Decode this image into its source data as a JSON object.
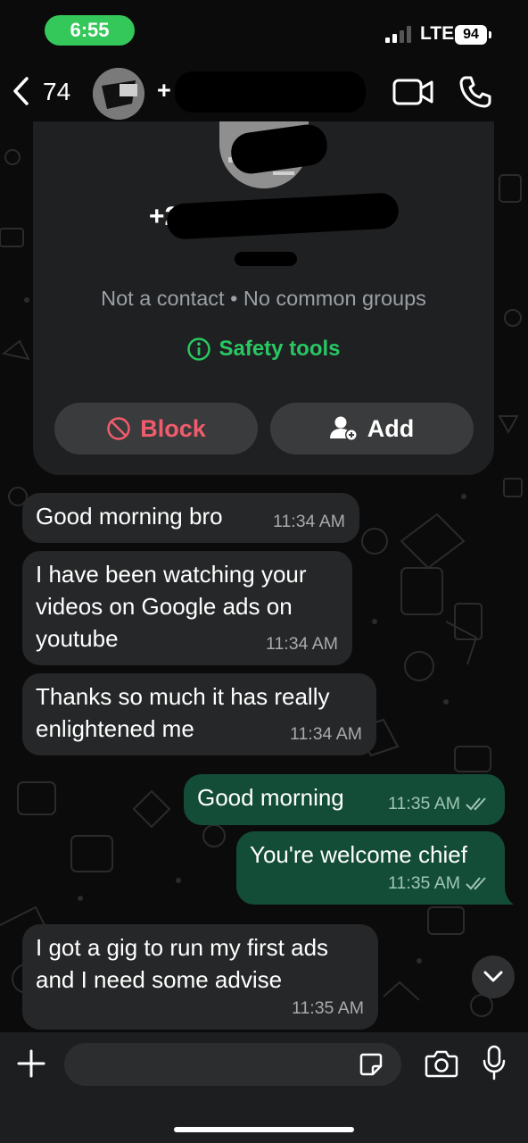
{
  "status_bar": {
    "time": "6:55",
    "network": "LTE",
    "battery": "94"
  },
  "header": {
    "unread_count": "74",
    "contact_name": "+",
    "icons": [
      "back-chevron-icon",
      "video-call-icon",
      "phone-call-icon"
    ]
  },
  "contact_card": {
    "phone_partial": "+23",
    "subtitle": "Not a contact • No common groups",
    "safety_tools": "Safety tools",
    "block_label": "Block",
    "add_label": "Add"
  },
  "messages": [
    {
      "direction": "in",
      "text": "Good morning bro",
      "time": "11:34 AM"
    },
    {
      "direction": "in",
      "text": "I have been watching your\nvideos on Google ads on\nyoutube",
      "time": "11:34 AM"
    },
    {
      "direction": "in",
      "text": "Thanks so much it has really\nenlightened me",
      "time": "11:34 AM"
    },
    {
      "direction": "out",
      "text": "Good morning",
      "time": "11:35 AM",
      "read": true
    },
    {
      "direction": "out",
      "text": "You're welcome chief",
      "time": "11:35 AM",
      "read": true
    },
    {
      "direction": "in",
      "text": "I got a gig to run my first ads\nand I need some advise",
      "time": "11:35 AM"
    }
  ],
  "composer": {
    "placeholder": "",
    "icons": [
      "plus-icon",
      "sticker-icon",
      "camera-icon",
      "microphone-icon"
    ]
  },
  "colors": {
    "accent_green": "#29c763",
    "status_pill": "#34c759",
    "incoming_bubble": "#262728",
    "outgoing_bubble": "#144d37",
    "block_red": "#f15c6d",
    "read_ticks": "#9fc6b5"
  }
}
